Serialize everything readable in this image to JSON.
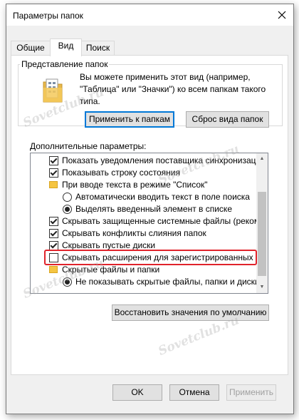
{
  "window": {
    "title": "Параметры папок"
  },
  "tabs": [
    {
      "label": "Общие"
    },
    {
      "label": "Вид"
    },
    {
      "label": "Поиск"
    }
  ],
  "folder_view": {
    "group_label": "Представление папок",
    "description": "Вы можете применить этот вид (например, \"Таблица\" или \"Значки\") ко всем папкам такого типа.",
    "apply_button": "Применить к папкам",
    "reset_button": "Сброс вида папок"
  },
  "advanced": {
    "label": "Дополнительные параметры:",
    "items": [
      {
        "type": "checkbox",
        "checked": true,
        "label": "Показать уведомления поставщика синхронизации"
      },
      {
        "type": "checkbox",
        "checked": true,
        "label": "Показывать строку состояния"
      },
      {
        "type": "folder",
        "label": "При вводе текста в режиме \"Список\""
      },
      {
        "type": "radio",
        "checked": false,
        "label": "Автоматически вводить текст в поле поиска"
      },
      {
        "type": "radio",
        "checked": true,
        "label": "Выделять введенный элемент в списке"
      },
      {
        "type": "checkbox",
        "checked": true,
        "label": "Скрывать защищенные системные файлы (реком"
      },
      {
        "type": "checkbox",
        "checked": true,
        "label": "Скрывать конфликты слияния папок"
      },
      {
        "type": "checkbox",
        "checked": true,
        "label": "Скрывать пустые диски"
      },
      {
        "type": "checkbox",
        "checked": false,
        "label": "Скрывать расширения для зарегистрированных типо"
      },
      {
        "type": "folder",
        "label": "Скрытые файлы и папки"
      },
      {
        "type": "radio",
        "checked": true,
        "label": "Не показывать скрытые файлы, папки и диски"
      }
    ]
  },
  "restore_button": "Восстановить значения по умолчанию",
  "footer": {
    "ok": "OK",
    "cancel": "Отмена",
    "apply": "Применить"
  },
  "watermark": "Sovetclub.ru",
  "colors": {
    "highlight": "#e0232b",
    "accent": "#0078d7"
  }
}
